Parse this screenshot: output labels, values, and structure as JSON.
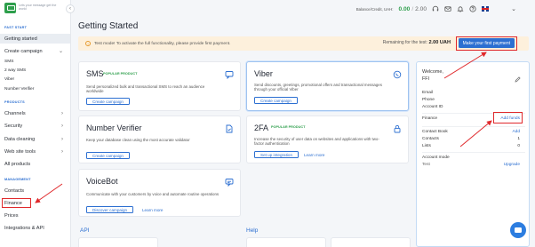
{
  "sidebar": {
    "tagline": "Lets your message get the world",
    "sections": {
      "fast_start": "FAST START",
      "products": "PRODUCTS",
      "management": "MANAGEMENT"
    },
    "fast_start_items": [
      "Getting started",
      "Create campaign",
      "SMS",
      "2 way SMS",
      "Viber",
      "Number Verifier"
    ],
    "product_items": [
      "Channels",
      "Security",
      "Data cleaning",
      "Web site tools",
      "All products"
    ],
    "management_items": [
      "Contacts",
      "Finance",
      "Prices",
      "Integrations & API"
    ]
  },
  "topbar": {
    "balance_label": "Balance/Credit, UAH:",
    "balance_value": "0.00",
    "balance_separator": "/",
    "balance_max": "2.00"
  },
  "page": {
    "title": "Getting Started"
  },
  "notice": {
    "text": "Test mode! To activate the full functionality, please provide first payment.",
    "remaining_label": "Remaining for the test:",
    "remaining_value": "2.00 UAH",
    "button": "Make your first payment"
  },
  "cards": {
    "sms": {
      "title": "SMS",
      "badge": "POPULAR PRODUCT",
      "desc": "Send personalized bulk and transactional SMS to reach an audience worldwide",
      "button": "Create campaign"
    },
    "viber": {
      "title": "Viber",
      "desc": "Send discounts, greetings, promotional offers and transactional messages through your official Viber",
      "button": "Create campaign"
    },
    "number_verifier": {
      "title": "Number Verifier",
      "desc": "Keep your database clean using the most accurate validator",
      "button": "Create campaign"
    },
    "twofa": {
      "title": "2FA",
      "badge": "POPULAR PRODUCT",
      "desc": "Increase the security of user data on websites and applications with two-factor authentication",
      "button": "Set up integration",
      "link": "Learn more"
    },
    "voicebot": {
      "title": "VoiceBot",
      "desc": "Communicate with your customers by voice and automate routine operations",
      "button": "Discover campaign",
      "link": "Learn more"
    }
  },
  "bottom": {
    "api": "API",
    "help": "Help"
  },
  "panel": {
    "welcome": "Welcome,",
    "name_prefix": "FFI",
    "email_label": "Email",
    "phone_label": "Phone",
    "account_id_label": "Account ID",
    "finance_label": "Finance",
    "add_funds": "Add funds",
    "contact_book_label": "Contact Book",
    "contact_book_link": "Add",
    "contacts_label": "Contacts",
    "contacts_value": "1",
    "lists_label": "Lists",
    "lists_value": "0",
    "account_mode_label": "Account mode",
    "account_mode_value": "Test",
    "upgrade": "Upgrade"
  },
  "colors": {
    "brand_green": "#2e9f4c",
    "accent_blue": "#2c6fd1",
    "highlight_red": "#e0282b",
    "notice_bg": "#fdf0dc"
  },
  "icons": [
    "chevron-left-icon",
    "headset-icon",
    "mail-icon",
    "bell-icon",
    "help-icon",
    "uk-flag-icon",
    "chevron-down-icon",
    "chat-icon",
    "viber-icon",
    "document-check-icon",
    "lock-icon",
    "voicebot-icon",
    "pencil-icon"
  ]
}
